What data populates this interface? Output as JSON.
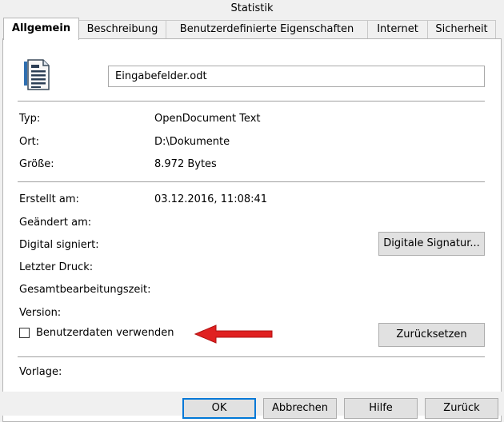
{
  "window": {
    "title": "Statistik"
  },
  "tabs": [
    {
      "label": "Allgemein",
      "active": true
    },
    {
      "label": "Beschreibung",
      "active": false
    },
    {
      "label": "Benutzerdefinierte Eigenschaften",
      "active": false
    },
    {
      "label": "Internet",
      "active": false
    },
    {
      "label": "Sicherheit",
      "active": false
    }
  ],
  "general": {
    "icon": "document-icon",
    "filename": "Eingabefelder.odt",
    "info": {
      "type_label": "Typ:",
      "type_value": "OpenDocument Text",
      "location_label": "Ort:",
      "location_value": "D:\\Dokumente",
      "size_label": "Größe:",
      "size_value": "8.972 Bytes"
    },
    "dates": {
      "created_label": "Erstellt am:",
      "created_value": "03.12.2016, 11:08:41",
      "modified_label": "Geändert am:",
      "signed_label": "Digital signiert:",
      "printed_label": "Letzter Druck:",
      "edit_time_label": "Gesamtbearbeitungszeit:",
      "version_label": "Version:"
    },
    "digital_signature_button": "Digitale Signatur...",
    "apply_user_data": {
      "label": "Benutzerdaten verwenden",
      "checked": false
    },
    "reset_button": "Zurücksetzen",
    "template_label": "Vorlage:"
  },
  "buttons": {
    "ok": "OK",
    "cancel": "Abbrechen",
    "help": "Hilfe",
    "back": "Zurück"
  },
  "colors": {
    "window_bg": "#f0f0f0",
    "panel_bg": "#ffffff",
    "button_bg": "#e1e1e1",
    "focus_border": "#0078d7",
    "arrow": "#e02020"
  }
}
